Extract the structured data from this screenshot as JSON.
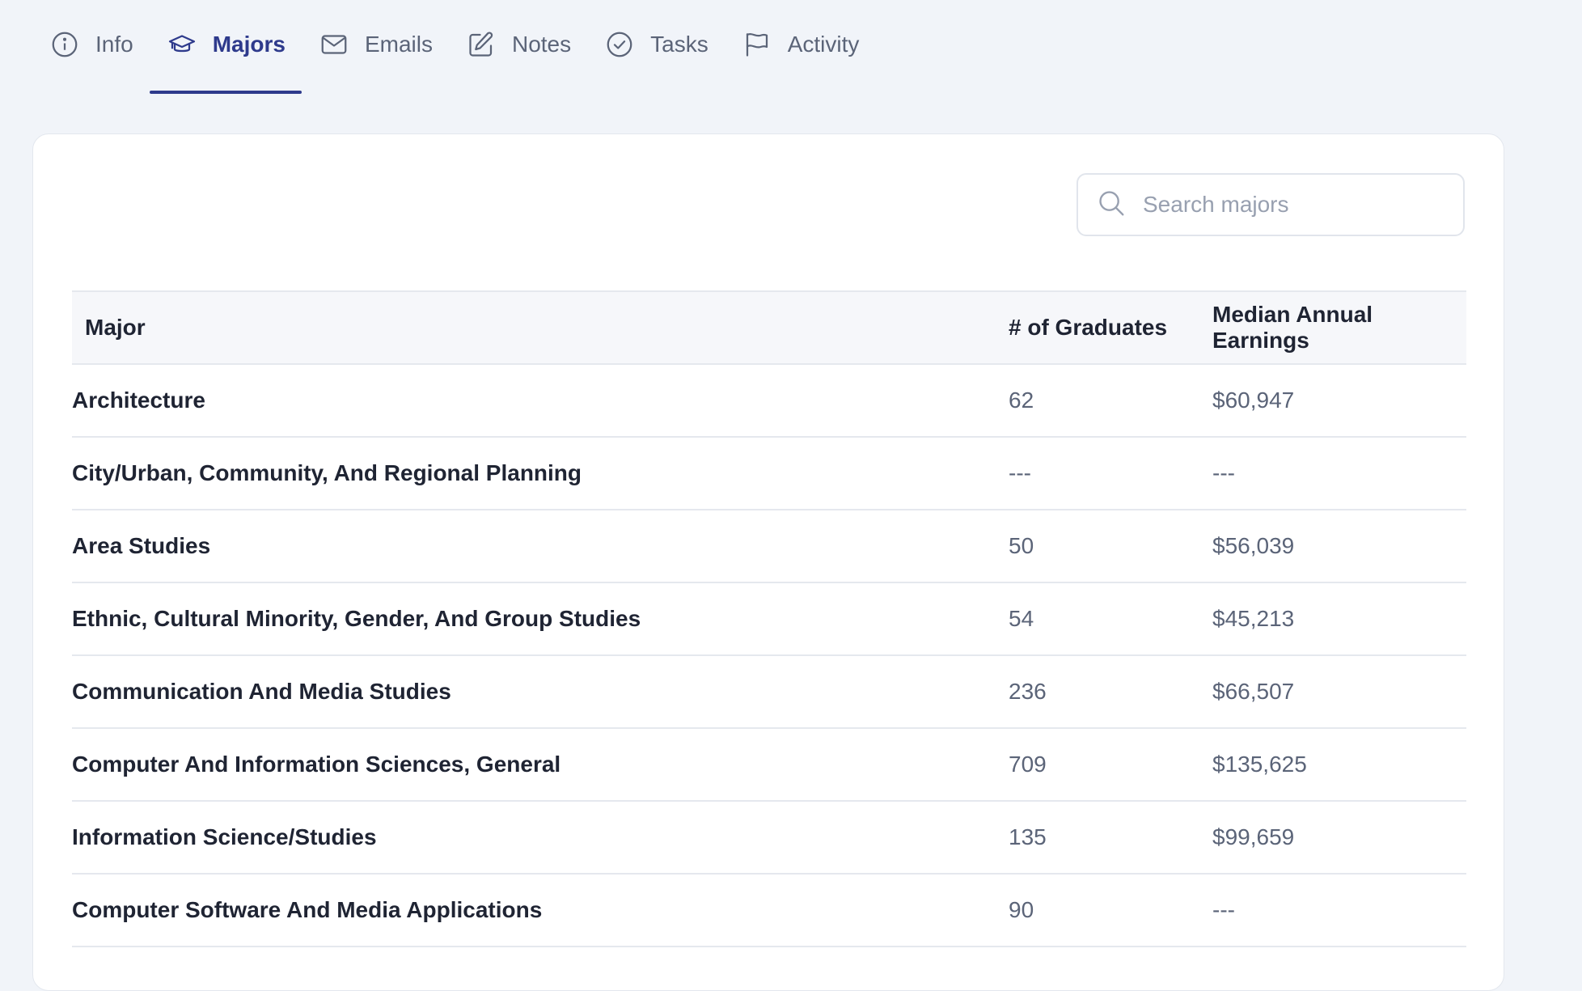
{
  "tabs": [
    {
      "label": "Info",
      "icon": "info-icon"
    },
    {
      "label": "Majors",
      "icon": "graduation-cap-icon",
      "active": true
    },
    {
      "label": "Emails",
      "icon": "envelope-icon"
    },
    {
      "label": "Notes",
      "icon": "edit-icon"
    },
    {
      "label": "Tasks",
      "icon": "check-circle-icon"
    },
    {
      "label": "Activity",
      "icon": "flag-icon"
    }
  ],
  "colors": {
    "accent": "#2e3a8c",
    "background": "#f1f4f9",
    "muted_text": "#5b6478",
    "strong_text": "#1f2433"
  },
  "search": {
    "placeholder": "Search majors",
    "value": ""
  },
  "table": {
    "headers": {
      "major": "Major",
      "graduates": "# of Graduates",
      "earnings": "Median Annual Earnings"
    },
    "rows": [
      {
        "major": "Architecture",
        "graduates": "62",
        "earnings": "$60,947"
      },
      {
        "major": "City/Urban, Community, And Regional Planning",
        "graduates": "---",
        "earnings": "---"
      },
      {
        "major": "Area Studies",
        "graduates": "50",
        "earnings": "$56,039"
      },
      {
        "major": "Ethnic, Cultural Minority, Gender, And Group Studies",
        "graduates": "54",
        "earnings": "$45,213"
      },
      {
        "major": "Communication And Media Studies",
        "graduates": "236",
        "earnings": "$66,507"
      },
      {
        "major": "Computer And Information Sciences, General",
        "graduates": "709",
        "earnings": "$135,625"
      },
      {
        "major": "Information Science/Studies",
        "graduates": "135",
        "earnings": "$99,659"
      },
      {
        "major": "Computer Software And Media Applications",
        "graduates": "90",
        "earnings": "---"
      }
    ]
  }
}
